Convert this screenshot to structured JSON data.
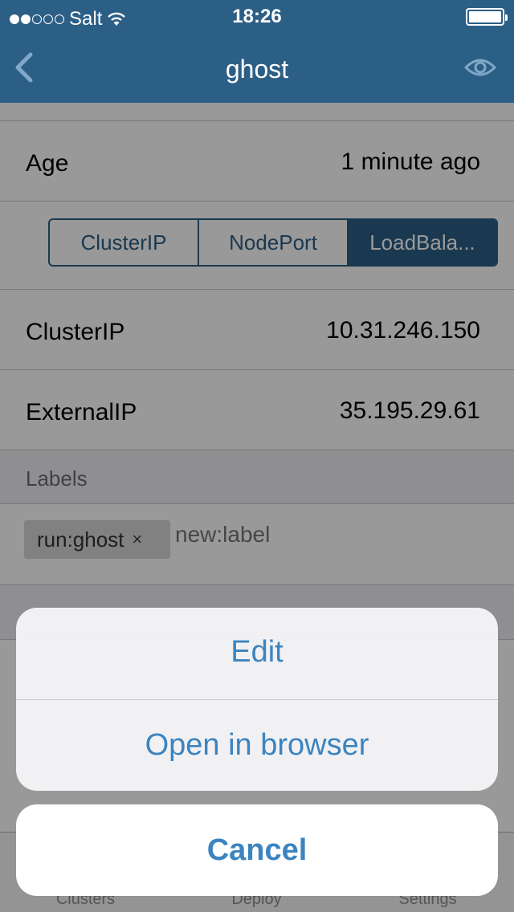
{
  "status_bar": {
    "carrier": "Salt",
    "time": "18:26",
    "signal_bars_filled": 2,
    "signal_bars_total": 5
  },
  "nav": {
    "title": "ghost",
    "back_icon": "chevron-left-icon",
    "view_icon": "eye-icon"
  },
  "details": {
    "age_label": "Age",
    "age_value": "1 minute ago",
    "cluster_ip_label": "ClusterIP",
    "cluster_ip_value": "10.31.246.150",
    "external_ip_label": "ExternalIP",
    "external_ip_value": "35.195.29.61"
  },
  "service_type": {
    "options": [
      "ClusterIP",
      "NodePort",
      "LoadBala..."
    ],
    "selected": "LoadBala..."
  },
  "labels": {
    "header": "Labels",
    "tags": [
      {
        "text": "run:ghost",
        "remove": "×"
      }
    ],
    "placeholder": "new:label"
  },
  "tabs": [
    "Clusters",
    "Deploy",
    "Settings"
  ],
  "action_sheet": {
    "actions": [
      "Edit",
      "Open in browser"
    ],
    "cancel": "Cancel"
  },
  "colors": {
    "nav_bar": "#2c5f86",
    "accent": "#3c84c0",
    "overlay": "rgba(0,0,0,0.40)"
  }
}
